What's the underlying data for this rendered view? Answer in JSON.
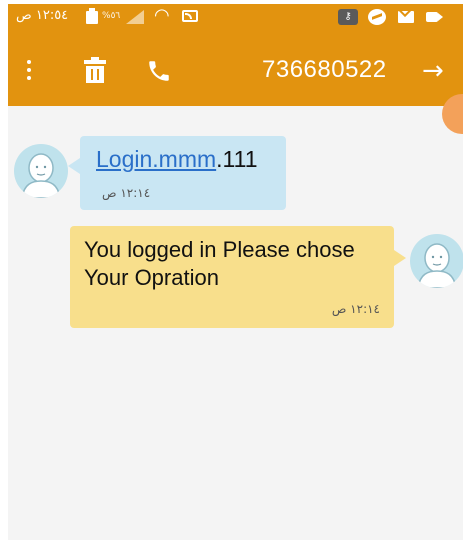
{
  "status_bar": {
    "time": "١٢:٥٤ ص",
    "battery_percent": "%٥٦"
  },
  "header": {
    "phone_number": "736680522"
  },
  "messages": [
    {
      "direction": "incoming",
      "link_text": "Login.mmm",
      "suffix_text": ".111",
      "time": "١٢:١٤ ص"
    },
    {
      "direction": "outgoing",
      "text": "You logged in Please chose Your Opration",
      "time": "١٢:١٤ ص"
    }
  ],
  "colors": {
    "accent": "#e2930f",
    "incoming_bubble": "#c9e6f3",
    "outgoing_bubble": "#f8df8c",
    "link": "#2a6fc9",
    "background": "#f4f4f4"
  }
}
